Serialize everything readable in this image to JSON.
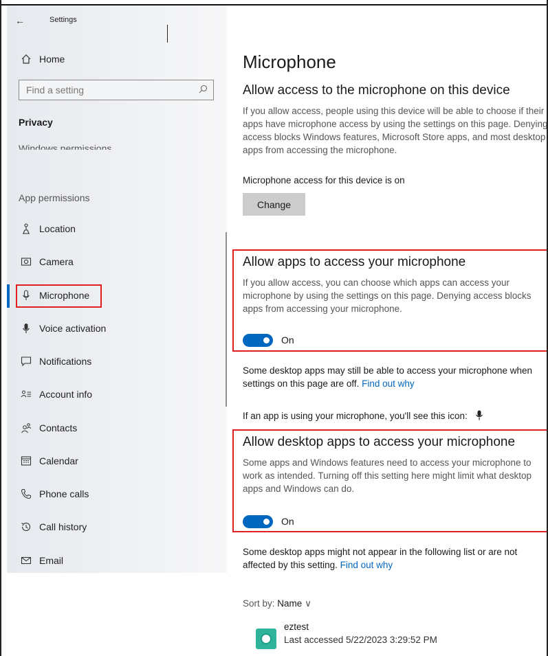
{
  "window": {
    "title": "Settings"
  },
  "sidebar": {
    "home": "Home",
    "search_placeholder": "Find a setting",
    "section": "Privacy",
    "partial_item": "Windows permissions",
    "group_label": "App permissions",
    "items": [
      {
        "label": "Location",
        "icon": "location-icon"
      },
      {
        "label": "Camera",
        "icon": "camera-icon"
      },
      {
        "label": "Microphone",
        "icon": "microphone-icon",
        "selected": true
      },
      {
        "label": "Voice activation",
        "icon": "voice-activation-icon"
      },
      {
        "label": "Notifications",
        "icon": "notifications-icon"
      },
      {
        "label": "Account info",
        "icon": "account-info-icon"
      },
      {
        "label": "Contacts",
        "icon": "contacts-icon"
      },
      {
        "label": "Calendar",
        "icon": "calendar-icon"
      },
      {
        "label": "Phone calls",
        "icon": "phone-icon"
      },
      {
        "label": "Call history",
        "icon": "history-icon"
      },
      {
        "label": "Email",
        "icon": "email-icon"
      }
    ]
  },
  "main": {
    "title": "Microphone",
    "device_section": {
      "heading": "Allow access to the microphone on this device",
      "description": "If you allow access, people using this device will be able to choose if their apps have microphone access by using the settings on this page. Denying access blocks Windows features, Microsoft Store apps, and most desktop apps from accessing the microphone.",
      "status": "Microphone access for this device is on",
      "button": "Change"
    },
    "apps_section": {
      "heading": "Allow apps to access your microphone",
      "description": "If you allow access, you can choose which apps can access your microphone by using the settings on this page. Denying access blocks apps from accessing your microphone.",
      "toggle_label": "On",
      "toggle_on": true
    },
    "note1": {
      "text": "Some desktop apps may still be able to access your microphone when settings on this page are off.",
      "link": "Find out why"
    },
    "icon_note": "If an app is using your microphone, you'll see this icon:",
    "desktop_section": {
      "heading": "Allow desktop apps to access your microphone",
      "description": "Some apps and Windows features need to access your microphone to work as intended. Turning off this setting here might limit what desktop apps and Windows can do.",
      "toggle_label": "On",
      "toggle_on": true
    },
    "note2": {
      "text": "Some desktop apps might not appear in the following list or are not affected by this setting.",
      "link": "Find out why"
    },
    "sort": {
      "label": "Sort by:",
      "value": "Name",
      "chevron": "∨"
    },
    "apps": [
      {
        "name": "eztest",
        "last_accessed": "Last accessed 5/22/2023 3:29:52 PM"
      }
    ]
  },
  "colors": {
    "accent": "#0067c0",
    "highlight": "#e01e1e"
  }
}
